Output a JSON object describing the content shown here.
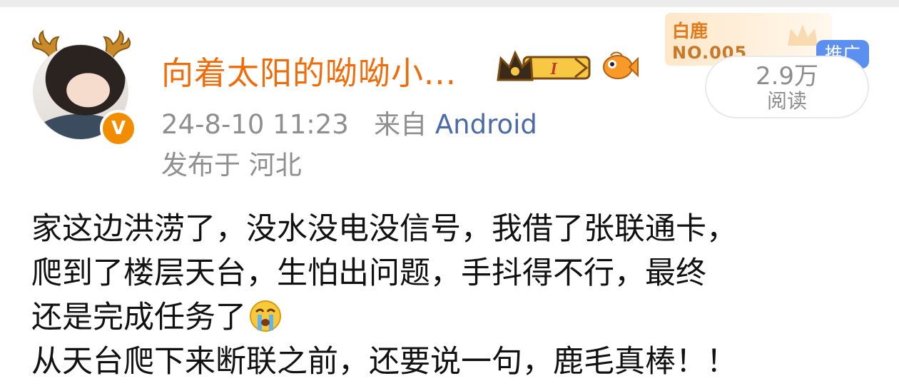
{
  "author": {
    "name": "向着太阳的呦呦小...",
    "level_badge": "I",
    "verified_mark": "V"
  },
  "meta": {
    "time": "24-8-10 11:23",
    "source_prefix": "来自",
    "source": "Android",
    "location": "发布于 河北"
  },
  "fan_card": {
    "name": "白鹿",
    "number": "NO.005"
  },
  "promo_tag": "推广",
  "reads": {
    "count": "2.9万",
    "label": "阅读"
  },
  "post": {
    "lines": [
      "家这边洪涝了，没水没电没信号，我借了张联通卡，",
      "爬到了楼层天台，生怕出问题，手抖得不行，最终",
      "还是完成任务了",
      "从天台爬下来断联之前，还要说一句，鹿毛真棒！！"
    ],
    "emoji": "crying-face-icon"
  },
  "colors": {
    "username": "#f06c0a",
    "source_link": "#4a6aa8",
    "promo_tag": "#5b8ff0",
    "verified_badge": "#f28c00"
  }
}
